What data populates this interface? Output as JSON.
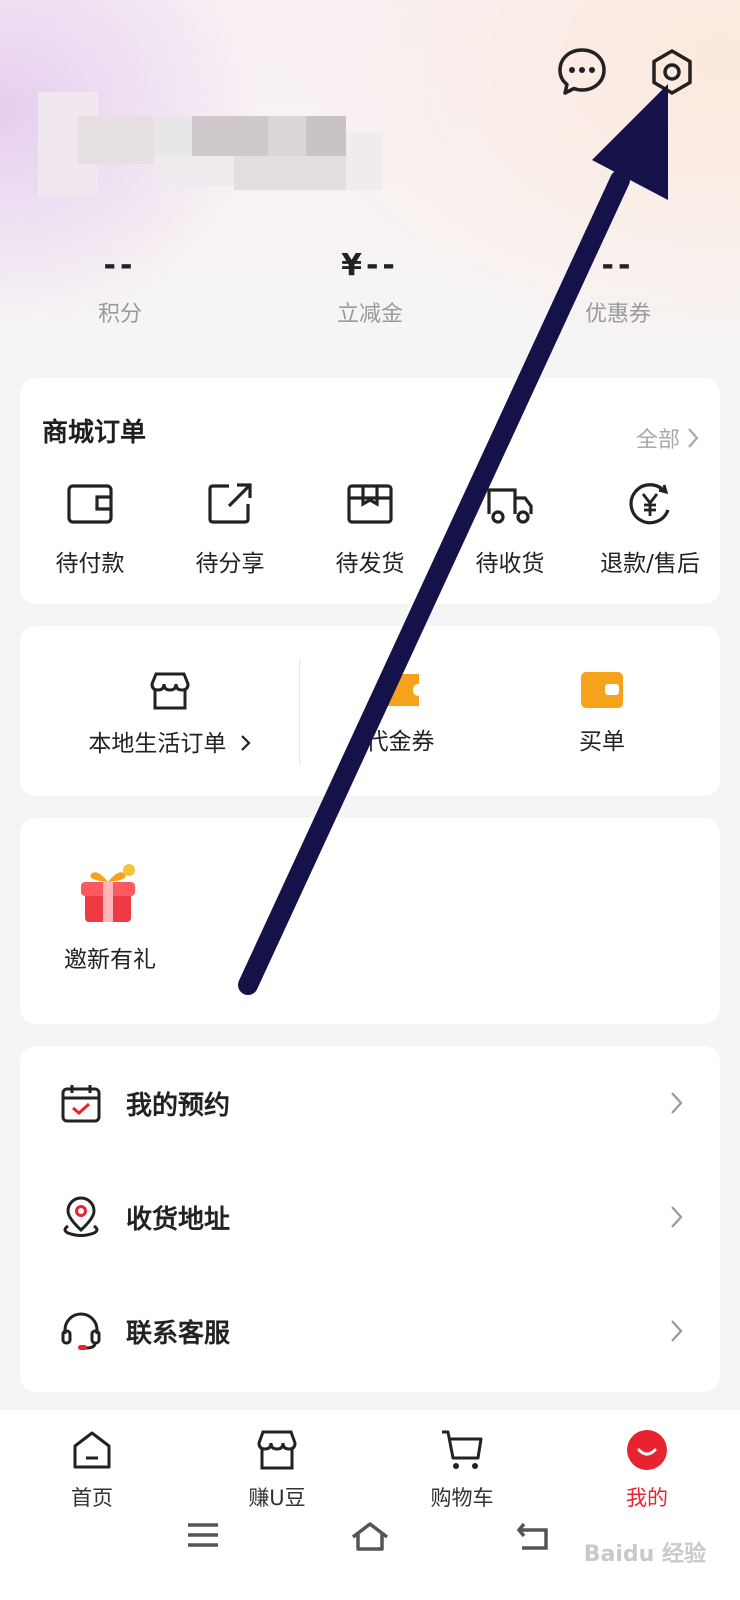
{
  "stats": [
    {
      "value": "--",
      "label": "积分"
    },
    {
      "value": "¥--",
      "label": "立减金"
    },
    {
      "value": "--",
      "label": "优惠券"
    }
  ],
  "mall_orders": {
    "title": "商城订单",
    "all_label": "全部",
    "items": [
      {
        "label": "待付款",
        "icon": "wallet-icon"
      },
      {
        "label": "待分享",
        "icon": "share-icon"
      },
      {
        "label": "待发货",
        "icon": "package-icon"
      },
      {
        "label": "待收货",
        "icon": "truck-icon"
      },
      {
        "label": "退款/售后",
        "icon": "refund-icon"
      }
    ]
  },
  "local_life": {
    "orders_label": "本地生活订单",
    "voucher_label": "代金券",
    "pay_label": "买单",
    "accent": "#f7a21b"
  },
  "invite": {
    "label": "邀新有礼",
    "icon": "gift-icon"
  },
  "menu": [
    {
      "label": "我的预约",
      "icon": "calendar-icon"
    },
    {
      "label": "收货地址",
      "icon": "location-icon"
    },
    {
      "label": "联系客服",
      "icon": "headset-icon"
    }
  ],
  "tabs": [
    {
      "label": "首页",
      "icon": "home-icon"
    },
    {
      "label": "赚U豆",
      "icon": "store-icon"
    },
    {
      "label": "购物车",
      "icon": "cart-icon"
    },
    {
      "label": "我的",
      "icon": "profile-icon",
      "active": true
    }
  ],
  "watermark": "Baidu 经验",
  "colors": {
    "active": "#e8232f",
    "arrow": "#15124a",
    "accent": "#e8232f"
  }
}
